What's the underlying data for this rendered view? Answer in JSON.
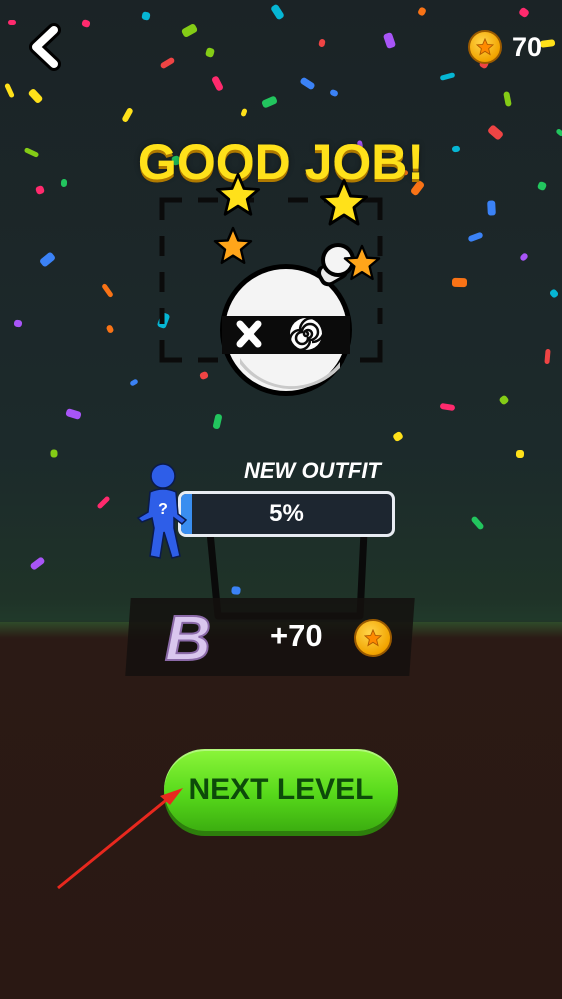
{
  "header": {
    "coins": "70",
    "back_icon": "chevron-left-icon",
    "coin_icon": "star-coin-icon"
  },
  "result": {
    "title": "GOOD JOB!"
  },
  "outfit": {
    "label": "NEW OUTFIT",
    "progress_text": "5%",
    "progress_fraction": 0.05
  },
  "reward": {
    "grade": "B",
    "amount": "+70"
  },
  "actions": {
    "next_label": "NEXT LEVEL"
  },
  "colors": {
    "title": "#ffe11a",
    "button": "#57d91b",
    "coin": "#f2a400",
    "progress_border": "#e8ecf2"
  }
}
